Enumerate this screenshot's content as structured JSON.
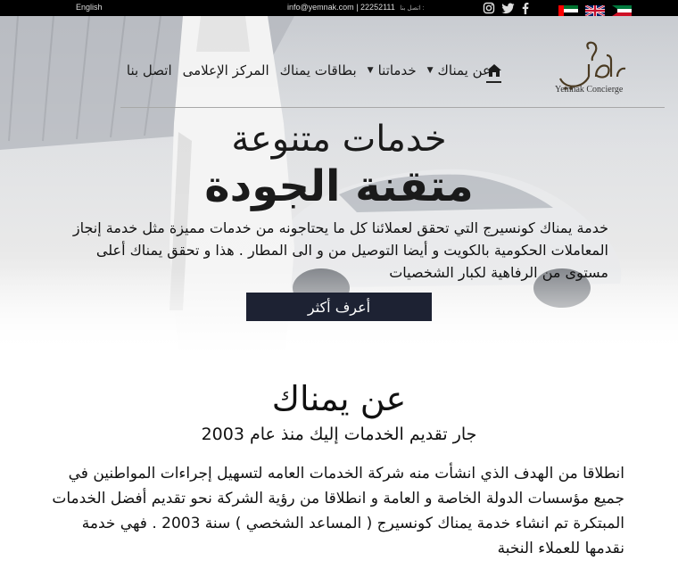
{
  "topbar": {
    "language_link": "English",
    "email": "info@yemnak.com",
    "separator": "|",
    "phone": "22252111",
    "contact_label": "اتصل بنا :"
  },
  "social_icons": [
    "instagram-icon",
    "twitter-icon",
    "facebook-icon"
  ],
  "flags": [
    "uae-flag",
    "uk-flag",
    "kuwait-flag"
  ],
  "logo": {
    "arabic": "يمناك",
    "subtitle": "Yemnak Concierge"
  },
  "nav": {
    "items": [
      {
        "label": "عن يمناك",
        "dropdown": true
      },
      {
        "label": "خدماتنا",
        "dropdown": true
      },
      {
        "label": "بطاقات يمناك",
        "dropdown": false
      },
      {
        "label": "المركز الإعلامى",
        "dropdown": false
      },
      {
        "label": "اتصل بنا",
        "dropdown": false
      }
    ]
  },
  "hero": {
    "title_line1": "خدمات متنوعة",
    "title_line2": "متقنة الجودة",
    "paragraph": "خدمة يمناك كونسيرج التي تحقق لعملائنا كل ما يحتاجونه من خدمات مميزة مثل خدمة إنجاز المعاملات الحكومية بالكويت و أيضا التوصيل من و الى المطار . هذا و تحقق يمناك أعلى مستوى من الرفاهية لكبار الشخصيات",
    "cta_label": "أعرف أكثر"
  },
  "about": {
    "title": "عن يمناك",
    "subtitle": "جار تقديم الخدمات إليك منذ عام 2003",
    "paragraph": "انطلاقا من الهدف الذي انشأت منه شركة الخدمات العامه لتسهيل إجراءات المواطنين في جميع مؤسسات الدولة الخاصة و العامة و انطلاقا من رؤية الشركة نحو تقديم أفضل الخدمات المبتكرة تم انشاء خدمة يمناك كونسيرج ( المساعد الشخصي ) سنة 2003 . فهي خدمة نقدمها للعملاء النخبة"
  }
}
